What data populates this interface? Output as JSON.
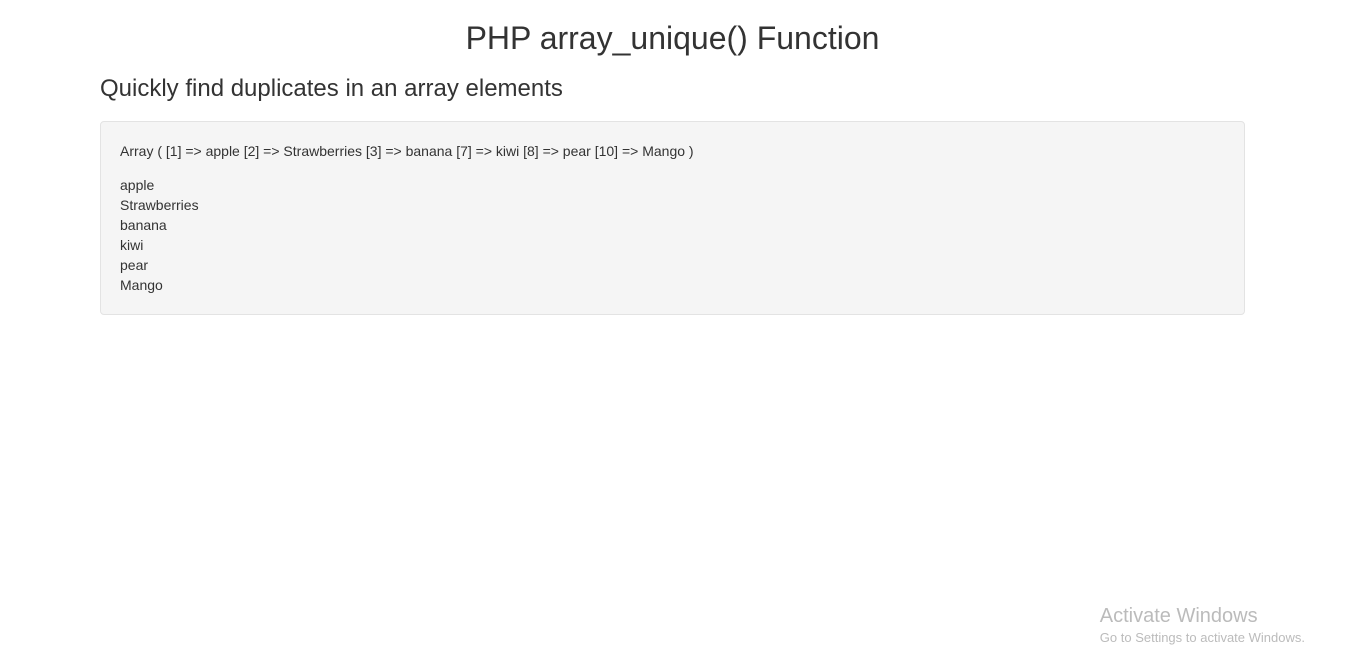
{
  "page": {
    "title": "PHP array_unique() Function",
    "subtitle": "Quickly find duplicates in an array elements"
  },
  "output": {
    "array_dump": "Array ( [1] => apple [2] => Strawberries [3] => banana [7] => kiwi [8] => pear [10] => Mango )",
    "items": {
      "0": "apple",
      "1": "Strawberries",
      "2": "banana",
      "3": "kiwi",
      "4": "pear",
      "5": "Mango"
    }
  },
  "watermark": {
    "title": "Activate Windows",
    "subtitle": "Go to Settings to activate Windows."
  }
}
